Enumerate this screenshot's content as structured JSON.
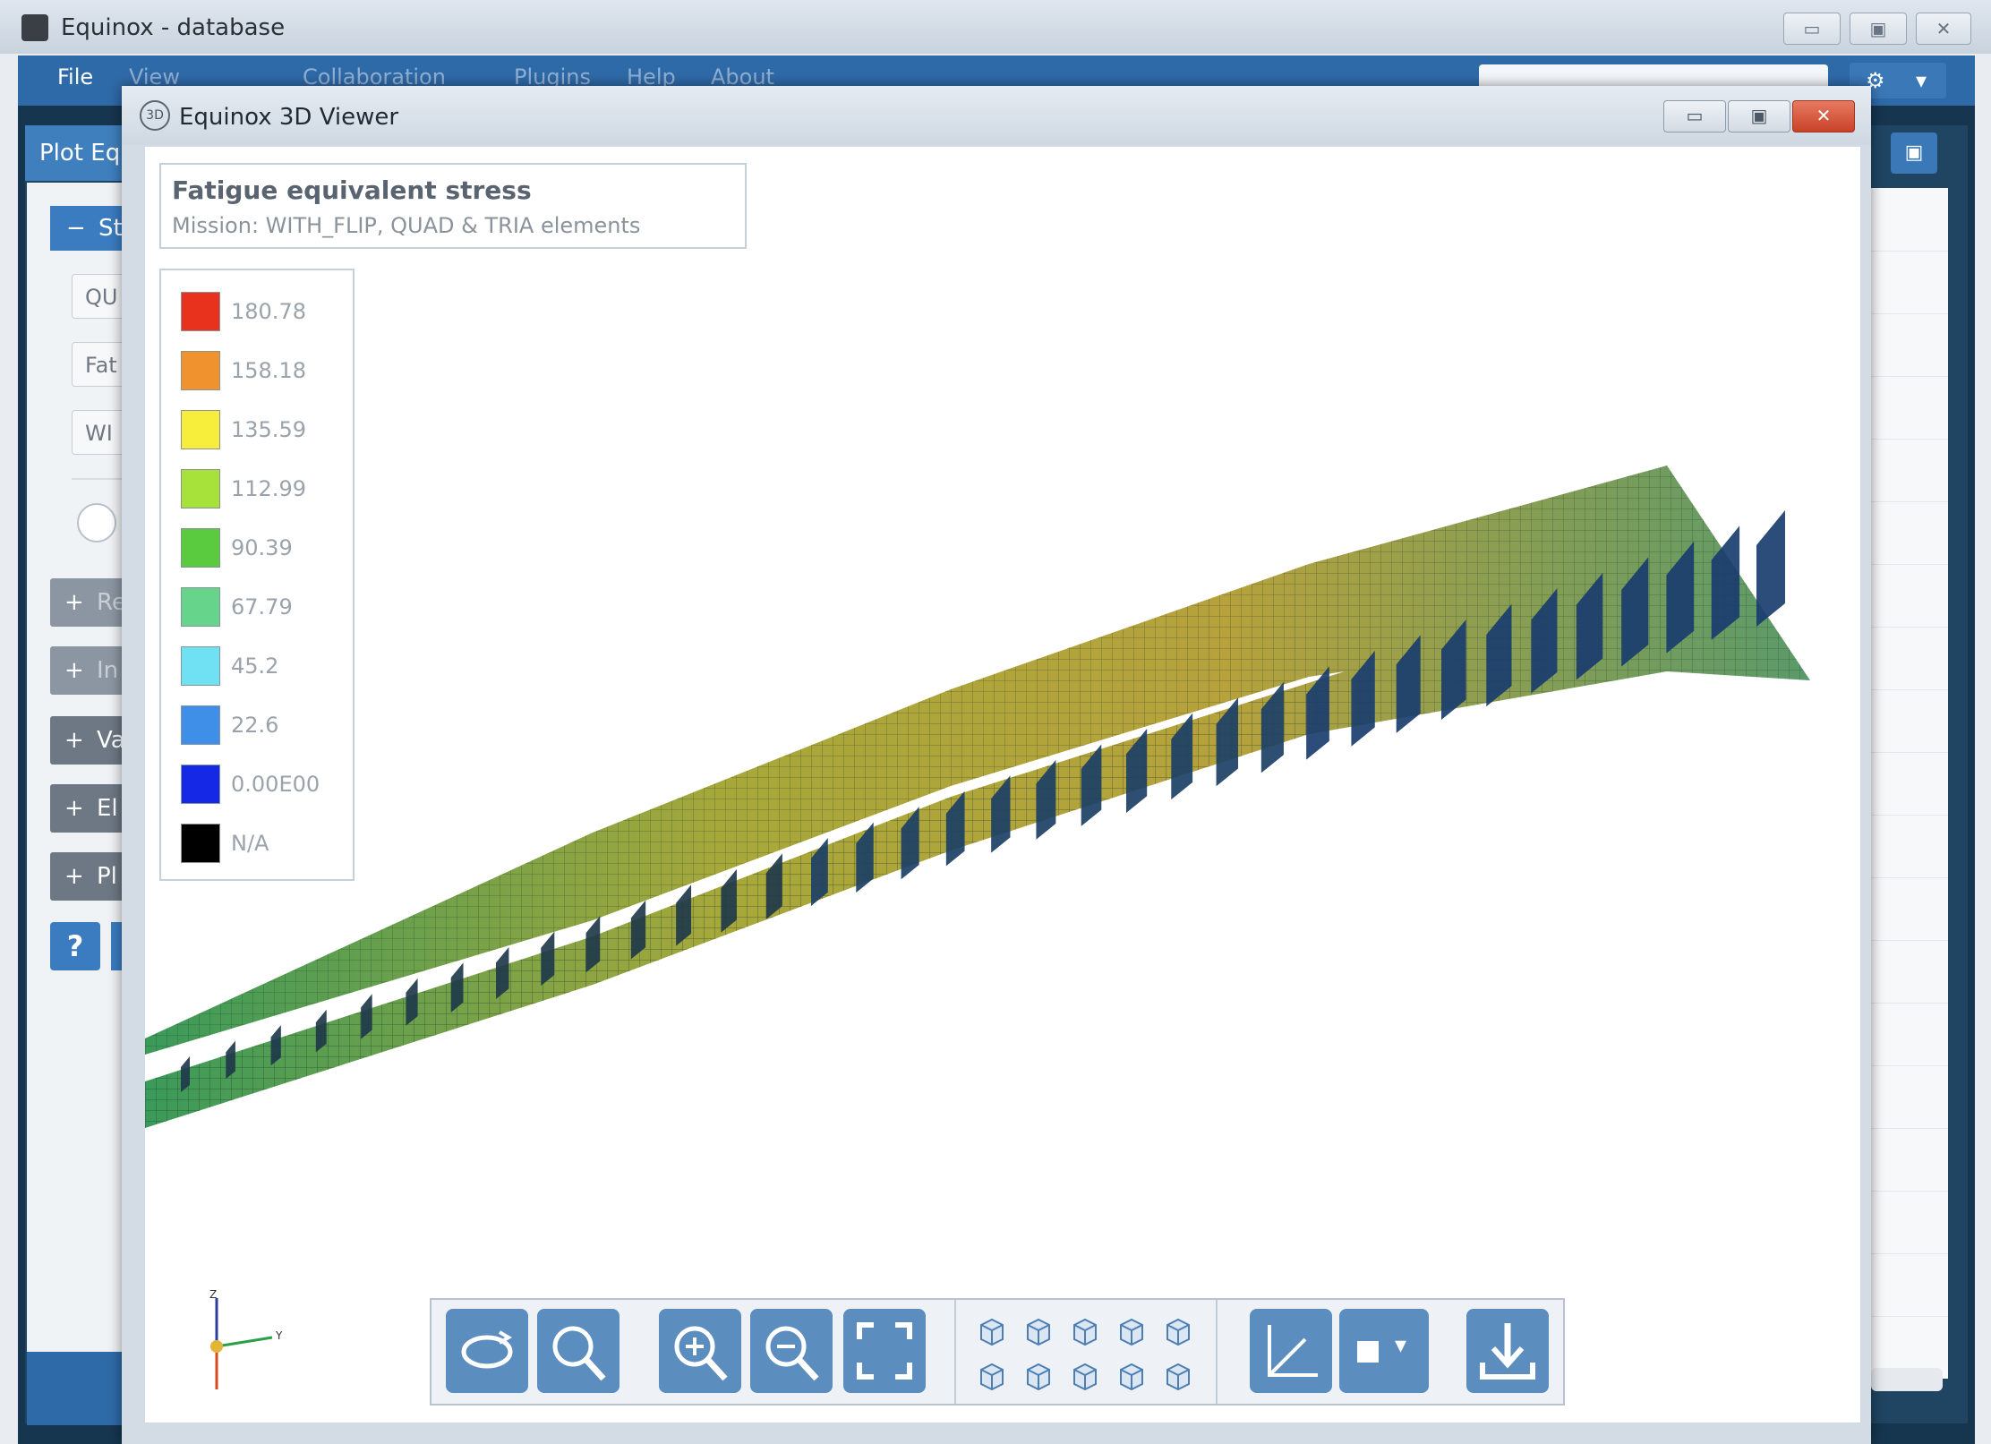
{
  "main_window": {
    "title": "Equinox - database",
    "controls": {
      "minimize": "▭",
      "maximize": "▣",
      "close": "✕"
    }
  },
  "menubar": {
    "items": [
      "File",
      "View",
      "Collaboration",
      "Plugins",
      "Help",
      "About"
    ],
    "settings_caret": "▾"
  },
  "plot_panel": {
    "title": "Plot Eq",
    "section_header": "St",
    "section_toggle": "−",
    "fields": [
      "QU",
      "Fat",
      "WI"
    ],
    "collapsed_sections": [
      {
        "sign": "+",
        "label": "Re"
      },
      {
        "sign": "+",
        "label": "In"
      },
      {
        "sign": "+",
        "label": "Va"
      },
      {
        "sign": "+",
        "label": "El"
      },
      {
        "sign": "+",
        "label": "Pl"
      }
    ],
    "help_label": "?"
  },
  "viewer": {
    "title": "Equinox 3D Viewer",
    "icon_label": "3D",
    "controls": {
      "minimize": "▭",
      "maximize": "▣",
      "close": "✕"
    }
  },
  "plot": {
    "heading": "Fatigue equivalent stress",
    "subtitle": "Mission: WITH_FLIP, QUAD & TRIA elements"
  },
  "legend": [
    {
      "label": "180.78",
      "color": "#e8321e"
    },
    {
      "label": "158.18",
      "color": "#f0932f"
    },
    {
      "label": "135.59",
      "color": "#f6ee3a"
    },
    {
      "label": "112.99",
      "color": "#a6e23a"
    },
    {
      "label": "90.39",
      "color": "#5acb3e"
    },
    {
      "label": "67.79",
      "color": "#66d48a"
    },
    {
      "label": "45.2",
      "color": "#6fe1f2"
    },
    {
      "label": "22.6",
      "color": "#3f8ee8"
    },
    {
      "label": "0.00E00",
      "color": "#1428e6"
    },
    {
      "label": "N/A",
      "color": "#000000"
    }
  ],
  "axes_labels": {
    "z": "Z",
    "y": "Y"
  },
  "toolbar": {
    "buttons": [
      "rotate-icon",
      "zoom-fit-icon",
      "zoom-in-icon",
      "zoom-out-icon",
      "fullscreen-icon",
      "view-cube-icons",
      "axes-icon",
      "render-mode-icon",
      "download-icon"
    ],
    "render_caret": "▾"
  }
}
